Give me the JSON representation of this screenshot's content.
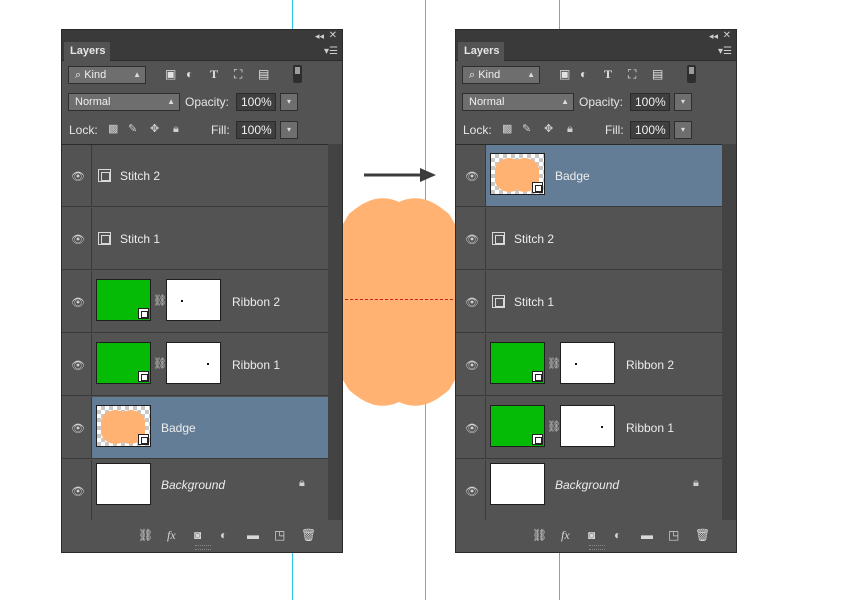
{
  "colors": {
    "guide": "#29c8e6",
    "blob": "#ffb272",
    "selection": "#647d96",
    "green": "#06bb06",
    "panel": "#535353"
  },
  "panels": [
    {
      "tab": "Layers",
      "kind": "Kind",
      "blend_mode": "Normal",
      "opacity_label": "Opacity:",
      "opacity_value": "100%",
      "lock_label": "Lock:",
      "fill_label": "Fill:",
      "fill_value": "100%",
      "layers": [
        {
          "name": "Stitch 2",
          "type": "smart-object-icon",
          "selected": false
        },
        {
          "name": "Stitch 1",
          "type": "smart-object-icon",
          "selected": false
        },
        {
          "name": "Ribbon 2",
          "type": "green-mask",
          "selected": false
        },
        {
          "name": "Ribbon 1",
          "type": "green-mask",
          "selected": false
        },
        {
          "name": "Badge",
          "type": "badge",
          "selected": true
        },
        {
          "name": "Background",
          "type": "background",
          "selected": false,
          "locked": true
        }
      ]
    },
    {
      "tab": "Layers",
      "kind": "Kind",
      "blend_mode": "Normal",
      "opacity_label": "Opacity:",
      "opacity_value": "100%",
      "lock_label": "Lock:",
      "fill_label": "Fill:",
      "fill_value": "100%",
      "layers": [
        {
          "name": "Badge",
          "type": "badge",
          "selected": true
        },
        {
          "name": "Stitch 2",
          "type": "smart-object-icon",
          "selected": false
        },
        {
          "name": "Stitch 1",
          "type": "smart-object-icon",
          "selected": false
        },
        {
          "name": "Ribbon 2",
          "type": "green-mask",
          "selected": false
        },
        {
          "name": "Ribbon 1",
          "type": "green-mask",
          "selected": false
        },
        {
          "name": "Background",
          "type": "background",
          "selected": false,
          "locked": true
        }
      ]
    }
  ]
}
